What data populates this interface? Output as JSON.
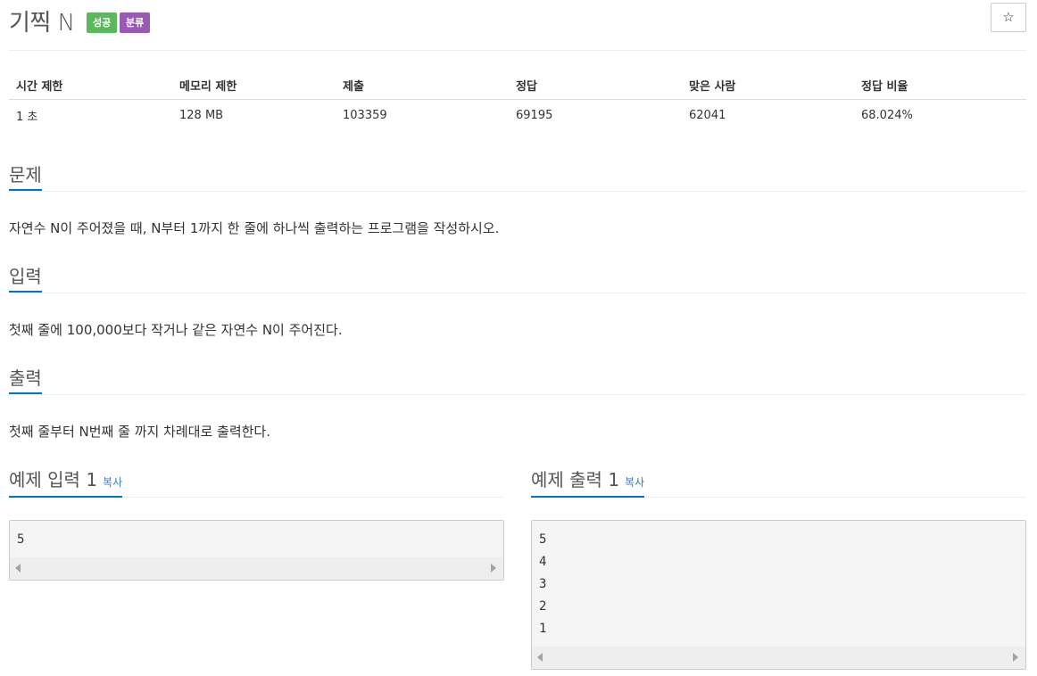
{
  "header": {
    "title": "기찍 N",
    "badge_success": "성공",
    "badge_category": "분류",
    "star_icon": "☆"
  },
  "info_table": {
    "headers": [
      "시간 제한",
      "메모리 제한",
      "제출",
      "정답",
      "맞은 사람",
      "정답 비율"
    ],
    "values": [
      "1 초",
      "128 MB",
      "103359",
      "69195",
      "62041",
      "68.024%"
    ]
  },
  "sections": {
    "problem": {
      "title": "문제",
      "text": "자연수 N이 주어졌을 때, N부터 1까지 한 줄에 하나씩 출력하는 프로그램을 작성하시오."
    },
    "input": {
      "title": "입력",
      "text": "첫째 줄에 100,000보다 작거나 같은 자연수 N이 주어진다."
    },
    "output": {
      "title": "출력",
      "text": "첫째 줄부터 N번째 줄 까지 차례대로 출력한다."
    }
  },
  "samples": {
    "input": {
      "title": "예제 입력 1",
      "copy_label": "복사",
      "lines": [
        "5"
      ]
    },
    "output": {
      "title": "예제 출력 1",
      "copy_label": "복사",
      "lines": [
        "5",
        "4",
        "3",
        "2",
        "1"
      ]
    }
  },
  "colors": {
    "accent": "#0076c0",
    "success": "#5cb85c",
    "category": "#9b59b6",
    "link": "#337ab7"
  }
}
